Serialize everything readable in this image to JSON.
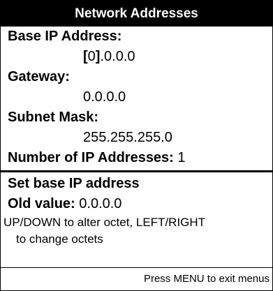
{
  "header": {
    "title": "Network Addresses"
  },
  "fields": {
    "base_ip_label": "Base IP Address:",
    "base_ip_open": "[",
    "base_ip_octet": "0",
    "base_ip_close": "]",
    "base_ip_rest": ".0.0.0",
    "gateway_label": "Gateway:",
    "gateway_value": "0.0.0.0",
    "subnet_label": "Subnet Mask:",
    "subnet_value": "255.255.255.0",
    "count_label": "Number of IP Addresses:",
    "count_value": "1"
  },
  "edit": {
    "title": "Set base IP address",
    "old_label": "Old value:",
    "old_value": "0.0.0.0",
    "hint_line1": "UP/DOWN to alter octet, LEFT/RIGHT",
    "hint_line2": "to change octets"
  },
  "footer": {
    "text": "Press MENU to exit menus"
  }
}
